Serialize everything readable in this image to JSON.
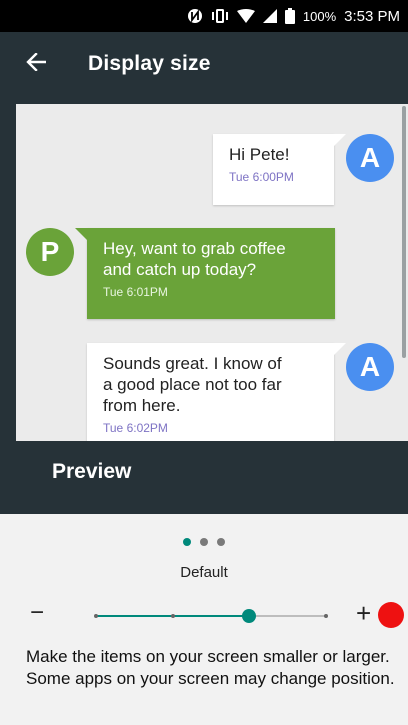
{
  "status_bar": {
    "icons": [
      "nfc-icon",
      "vibrate-icon",
      "wifi-icon",
      "signal-icon",
      "battery-icon"
    ],
    "battery": "100%",
    "time": "3:53 PM"
  },
  "app_bar": {
    "back_icon": "arrow-left-icon",
    "title": "Display size"
  },
  "preview": {
    "messages": [
      {
        "text": "Hi Pete!",
        "time": "Tue 6:00PM",
        "avatar": "A",
        "side": "right"
      },
      {
        "text": "Hey, want to grab coffee\nand catch up today?",
        "time": "Tue 6:01PM",
        "avatar": "P",
        "side": "left"
      },
      {
        "text": "Sounds great. I know of\na good place not too far\nfrom here.",
        "time": "Tue 6:02PM",
        "avatar": "A",
        "side": "right"
      }
    ],
    "label": "Preview"
  },
  "controls": {
    "page_dots": 3,
    "active_dot": 0,
    "size_label": "Default",
    "minus_label": "−",
    "plus_label": "+",
    "slider": {
      "steps": 4,
      "value_index": 2
    },
    "description": "Make the items on your screen smaller or larger. Some apps on your screen may change position."
  },
  "colors": {
    "app_bar": "#263238",
    "accent": "#00897b",
    "avatar_a": "#4a8ff0",
    "avatar_p": "#6aa339",
    "bubble_left": "#6aa339",
    "timestamp": "#7e73c4",
    "red_dot": "#ee1111"
  }
}
